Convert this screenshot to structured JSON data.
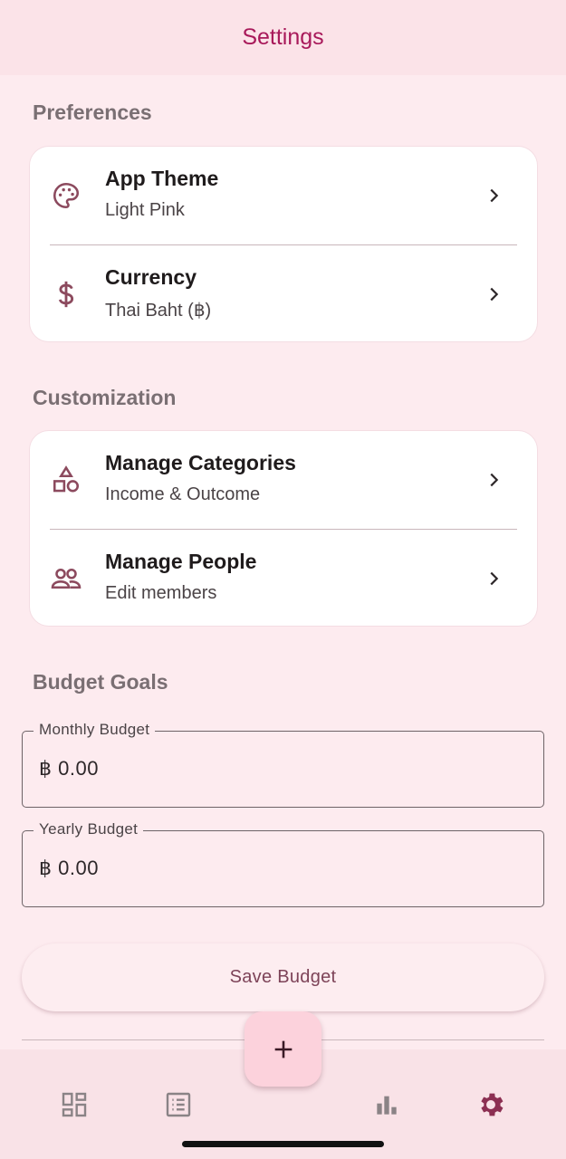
{
  "header": {
    "title": "Settings"
  },
  "preferences": {
    "section_title": "Preferences",
    "items": [
      {
        "title": "App Theme",
        "subtitle": "Light Pink",
        "icon": "palette-icon"
      },
      {
        "title": "Currency",
        "subtitle": "Thai Baht (฿)",
        "icon": "dollar-icon"
      }
    ]
  },
  "customization": {
    "section_title": "Customization",
    "items": [
      {
        "title": "Manage Categories",
        "subtitle": "Income & Outcome",
        "icon": "shapes-icon"
      },
      {
        "title": "Manage People",
        "subtitle": "Edit members",
        "icon": "people-icon"
      }
    ]
  },
  "budget": {
    "section_title": "Budget Goals",
    "monthly": {
      "label": "Monthly Budget",
      "value": "฿ 0.00"
    },
    "yearly": {
      "label": "Yearly Budget",
      "value": "฿ 0.00"
    },
    "save_label": "Save Budget"
  },
  "nav": {
    "items": [
      "dashboard-icon",
      "list-icon",
      "add-icon",
      "chart-icon",
      "settings-icon"
    ],
    "active": "settings-icon"
  },
  "colors": {
    "accent": "#a8195a",
    "icon": "#8c4a5e",
    "nav_inactive": "#8a8386",
    "background": "#fdebef"
  }
}
